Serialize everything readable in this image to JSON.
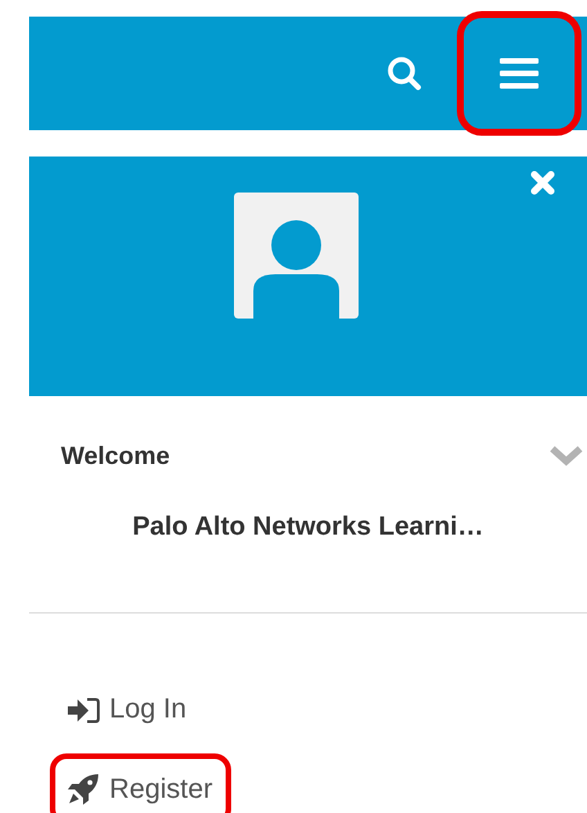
{
  "header": {
    "buttons": [
      {
        "kind": "search",
        "highlighted": false
      },
      {
        "kind": "menu",
        "highlighted": true
      }
    ]
  },
  "profile_panel": {
    "kind": "avatar"
  },
  "welcome": {
    "label": "Welcome"
  },
  "site_name": "Palo Alto Networks Learni…",
  "links": [
    {
      "kind": "login",
      "label": "Log In",
      "highlighted": false
    },
    {
      "kind": "register",
      "label": "Register",
      "highlighted": true
    }
  ]
}
